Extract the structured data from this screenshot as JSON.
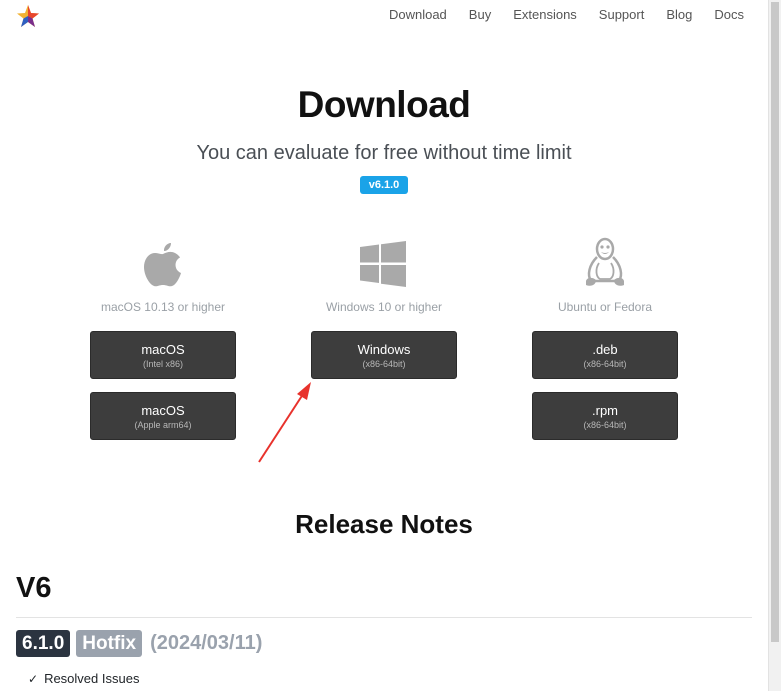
{
  "nav": {
    "items": [
      "Download",
      "Buy",
      "Extensions",
      "Support",
      "Blog",
      "Docs"
    ]
  },
  "hero": {
    "title": "Download",
    "subtitle": "You can evaluate for free without time limit",
    "version": "v6.1.0"
  },
  "platforms": {
    "mac": {
      "icon": "apple-icon",
      "requirement": "macOS 10.13 or higher",
      "buttons": [
        {
          "title": "macOS",
          "sub": "(Intel x86)"
        },
        {
          "title": "macOS",
          "sub": "(Apple arm64)"
        }
      ]
    },
    "windows": {
      "icon": "windows-icon",
      "requirement": "Windows 10 or higher",
      "buttons": [
        {
          "title": "Windows",
          "sub": "(x86-64bit)"
        }
      ]
    },
    "linux": {
      "icon": "linux-tux-icon",
      "requirement": "Ubuntu or Fedora",
      "buttons": [
        {
          "title": ".deb",
          "sub": "(x86-64bit)"
        },
        {
          "title": ".rpm",
          "sub": "(x86-64bit)"
        }
      ]
    }
  },
  "release": {
    "title": "Release Notes",
    "major": "V6",
    "latest": {
      "version": "6.1.0",
      "tag": "Hotfix",
      "date": "(2024/03/11)"
    },
    "section": "Resolved Issues"
  },
  "colors": {
    "accent": "#1aa3e8",
    "button": "#3d3d3d",
    "annotation_arrow": "#e8322c"
  }
}
